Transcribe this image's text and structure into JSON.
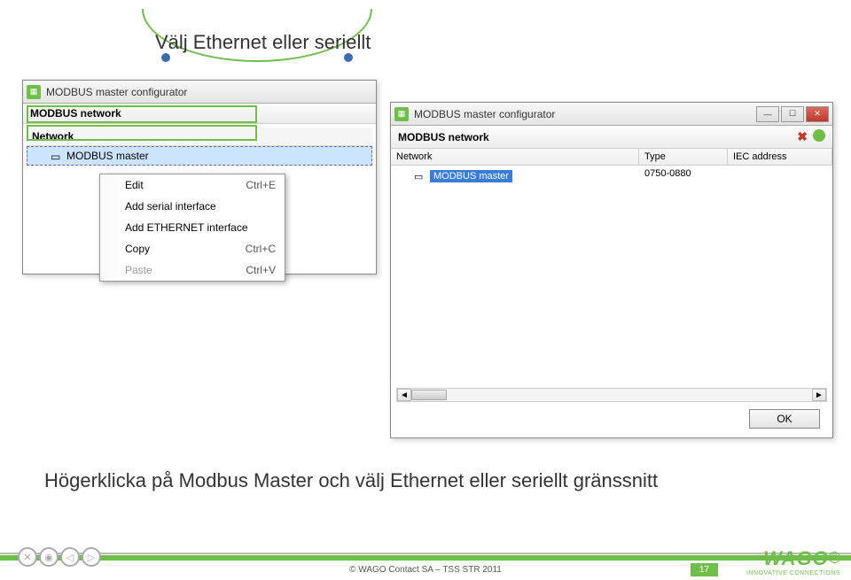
{
  "page_title": "Välj Ethernet eller seriellt",
  "bottom_text": "Högerklicka på Modbus Master och välj Ethernet eller seriellt gränssnitt",
  "left_window": {
    "title": "MODBUS master configurator",
    "panel": "MODBUS network",
    "col_network": "Network",
    "master_label": "MODBUS master"
  },
  "context_menu": {
    "edit": "Edit",
    "edit_sc": "Ctrl+E",
    "add_serial": "Add serial interface",
    "add_ethernet": "Add ETHERNET interface",
    "copy": "Copy",
    "copy_sc": "Ctrl+C",
    "paste": "Paste",
    "paste_sc": "Ctrl+V"
  },
  "right_window": {
    "title": "MODBUS master configurator",
    "panel": "MODBUS network",
    "col_network": "Network",
    "col_type": "Type",
    "col_iec": "IEC address",
    "master_label": "MODBUS master",
    "type_value": "0750-0880",
    "ok": "OK"
  },
  "footer": {
    "copyright": "© WAGO Contact SA – TSS STR 2011",
    "page": "17",
    "brand": "WAGO",
    "tagline": "INNOVATIVE CONNECTIONS"
  }
}
